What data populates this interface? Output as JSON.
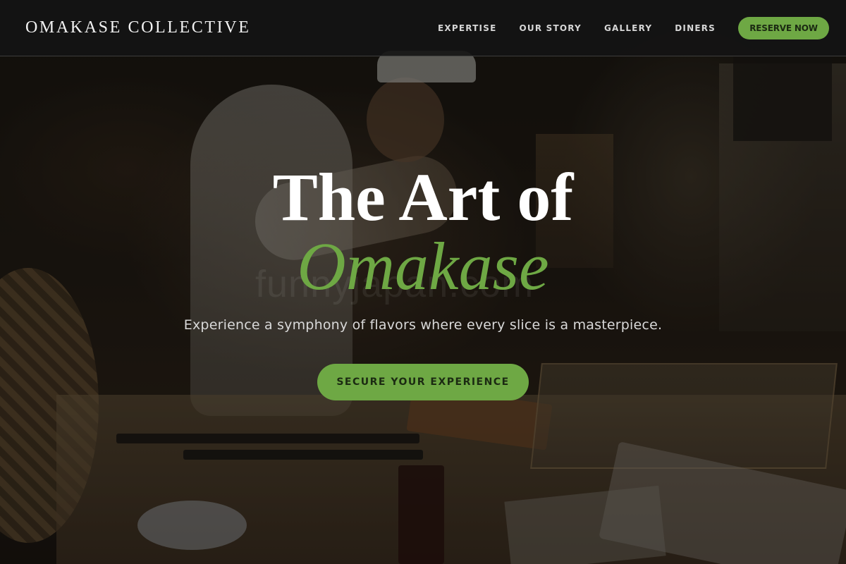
{
  "header": {
    "brand": "OMAKASE COLLECTIVE",
    "nav": [
      {
        "label": "EXPERTISE"
      },
      {
        "label": "OUR STORY"
      },
      {
        "label": "GALLERY"
      },
      {
        "label": "DINERS"
      }
    ],
    "reserve_label": "RESERVE NOW"
  },
  "hero": {
    "title_line1": "The Art of",
    "title_line2": "Omakase",
    "subtitle": "Experience a symphony of flavors where every slice is a masterpiece.",
    "cta_label": "SECURE YOUR EXPERIENCE",
    "watermark": "funnyjapan.com"
  },
  "colors": {
    "accent": "#6ea844",
    "nav_bg": "#141414",
    "text": "#ffffff"
  }
}
